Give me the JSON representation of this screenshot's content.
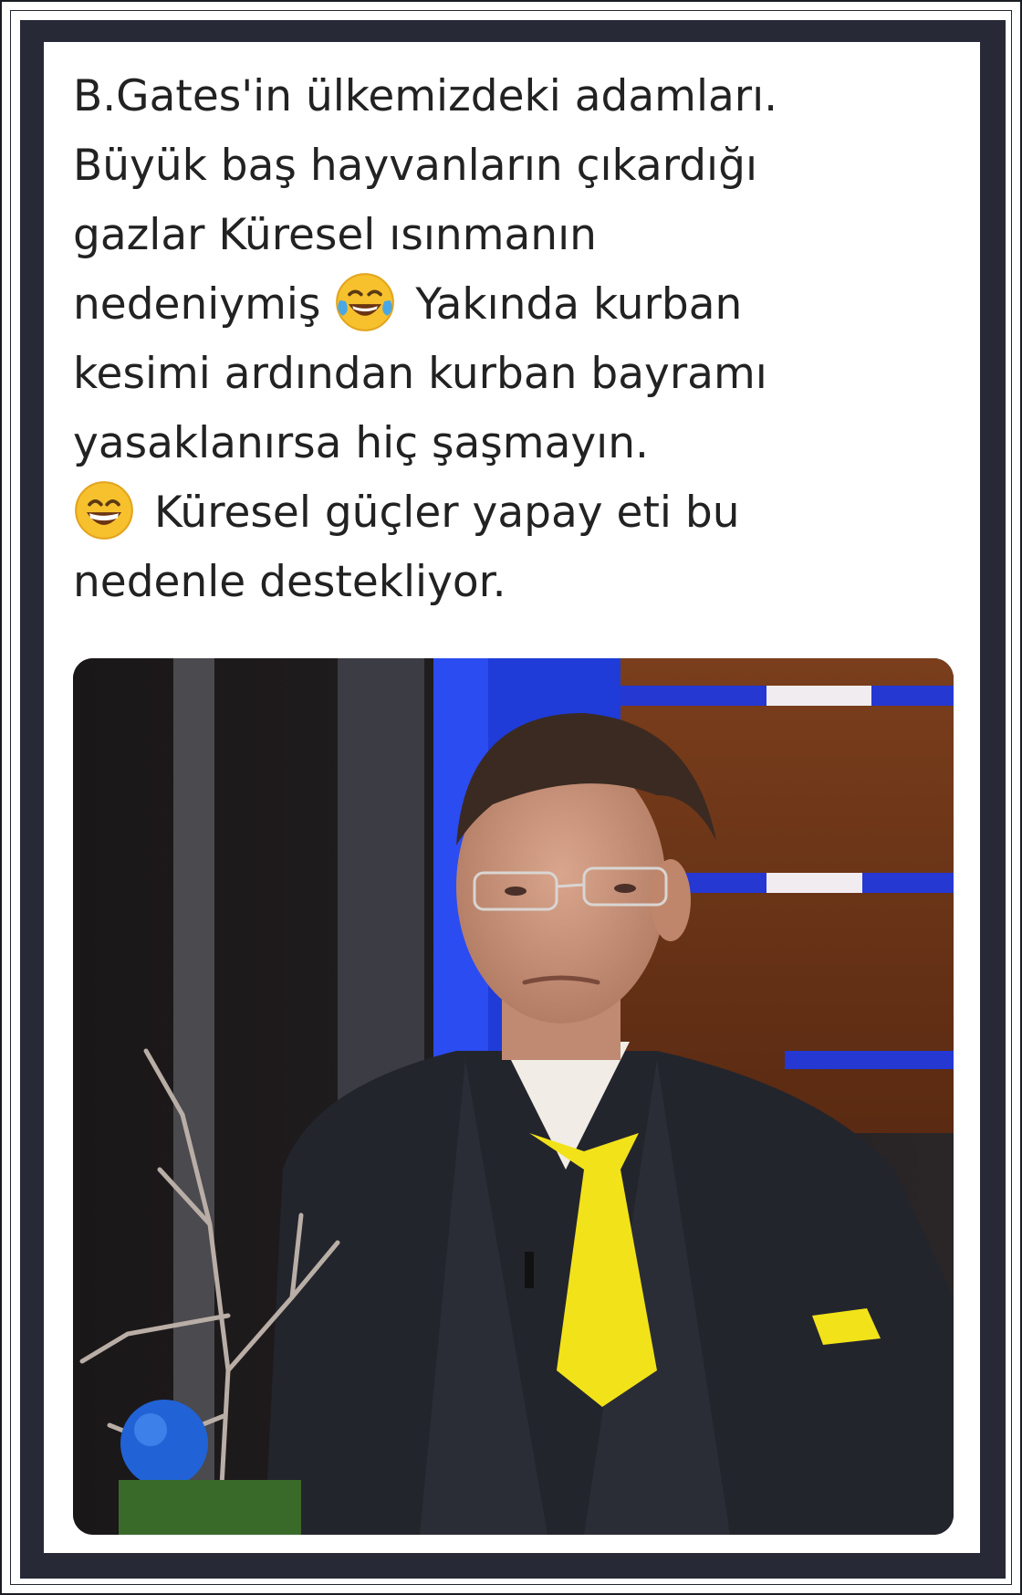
{
  "post": {
    "lines": {
      "l1": "B.Gates'in ülkemizdeki adamları.",
      "l2": "Büyük baş hayvanların çıkardığı",
      "l3": "gazlar Küresel ısınmanın",
      "l4a": "nedeniymiş",
      "l4b": "Yakında kurban",
      "l5": "kesimi ardından kurban bayramı",
      "l6": "yasaklanırsa hiç şaşmayın.",
      "l7": "Küresel güçler yapay eti bu",
      "l8": "nedenle destekliyor."
    },
    "emojis": {
      "first": "face-with-tears-of-joy-icon",
      "second": "grinning-squinting-face-icon"
    }
  },
  "media": {
    "kind": "video-still",
    "description_icon": "tv-studio-man-in-suit-image"
  },
  "colors": {
    "frame": "#272936",
    "text": "#222222",
    "tie": "#f2e21a",
    "studio_blue": "#1f3cd8"
  }
}
